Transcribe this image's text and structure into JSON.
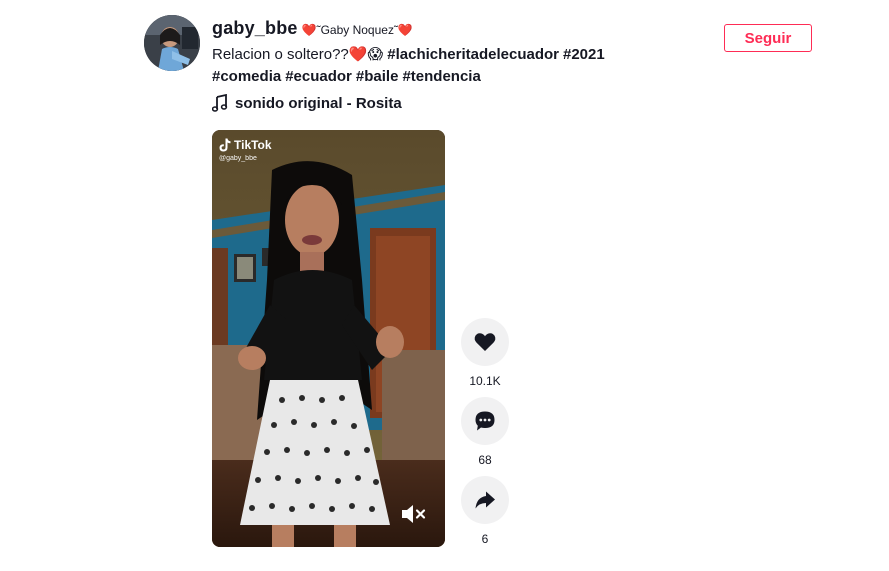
{
  "author": {
    "username": "gaby_bbe",
    "nickname": "❤️˜Gaby Noquez˜❤️",
    "avatar_icon": "avatar-photo"
  },
  "follow_label": "Seguir",
  "caption": {
    "text": "Relacion o soltero??❤️😱",
    "hashtags_line1": [
      "#lachicheritadelecuador",
      "#2021"
    ],
    "hashtags_line2": [
      "#comedia",
      "#ecuador",
      "#baile",
      "#tendencia"
    ]
  },
  "music": {
    "icon": "music-note-icon",
    "title": "sonido original - Rosita"
  },
  "video": {
    "watermark_brand": "TikTok",
    "watermark_handle": "@gaby_bbe",
    "mute_icon": "volume-muted-icon"
  },
  "actions": {
    "likes": "10.1K",
    "comments": "68",
    "shares": "6"
  },
  "colors": {
    "accent": "#fe2c55",
    "text": "#161823",
    "action_bg": "#f1f1f2"
  }
}
